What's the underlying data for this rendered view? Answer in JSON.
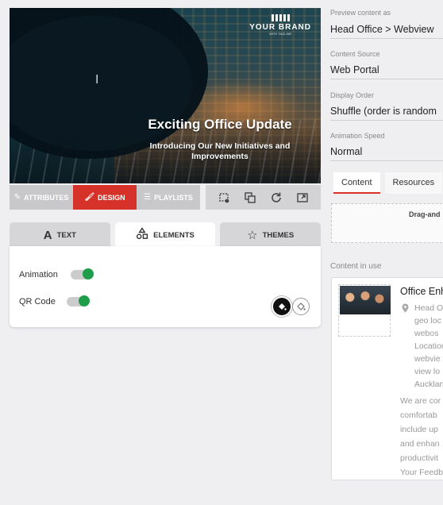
{
  "preview": {
    "brand_name": "YOUR BRAND",
    "brand_tagline": "WITH TAGLINE",
    "title": "Exciting Office Update",
    "subtitle": "Introducing Our New Initiatives and Improvements"
  },
  "modes": [
    {
      "label": "ATTRIBUTES",
      "icon": "edit-icon"
    },
    {
      "label": "DESIGN",
      "icon": "brush-icon",
      "active": true
    },
    {
      "label": "PLAYLISTS",
      "icon": "list-icon"
    }
  ],
  "tabs": [
    {
      "label": "TEXT",
      "icon": "A"
    },
    {
      "label": "ELEMENTS",
      "icon": "shapes",
      "active": true
    },
    {
      "label": "THEMES",
      "icon": "star"
    }
  ],
  "elements": {
    "animation_label": "Animation",
    "animation_on": true,
    "qr_label": "QR Code",
    "qr_on": true
  },
  "settings": {
    "preview_label": "Preview content as",
    "preview_value": "Head Office > Webview",
    "source_label": "Content Source",
    "source_value": "Web Portal",
    "order_label": "Display Order",
    "order_value": "Shuffle (order is random",
    "speed_label": "Animation Speed",
    "speed_value": "Normal"
  },
  "content_tabs": [
    "Content",
    "Resources"
  ],
  "drop_text": "Drag-and",
  "in_use": {
    "label": "Content in use",
    "title": "Office Enh",
    "location_lines": [
      "Head O",
      "geo loc",
      "webos",
      "Location",
      "webvie",
      "view lo",
      "Aucklan"
    ],
    "desc_lines": [
      "We are cor",
      "comfortab",
      "include up",
      "and enhan",
      "productivit",
      "Your Feedb"
    ]
  },
  "colors": {
    "accent": "#d7322a",
    "toggle_on": "#1e9e4a"
  }
}
